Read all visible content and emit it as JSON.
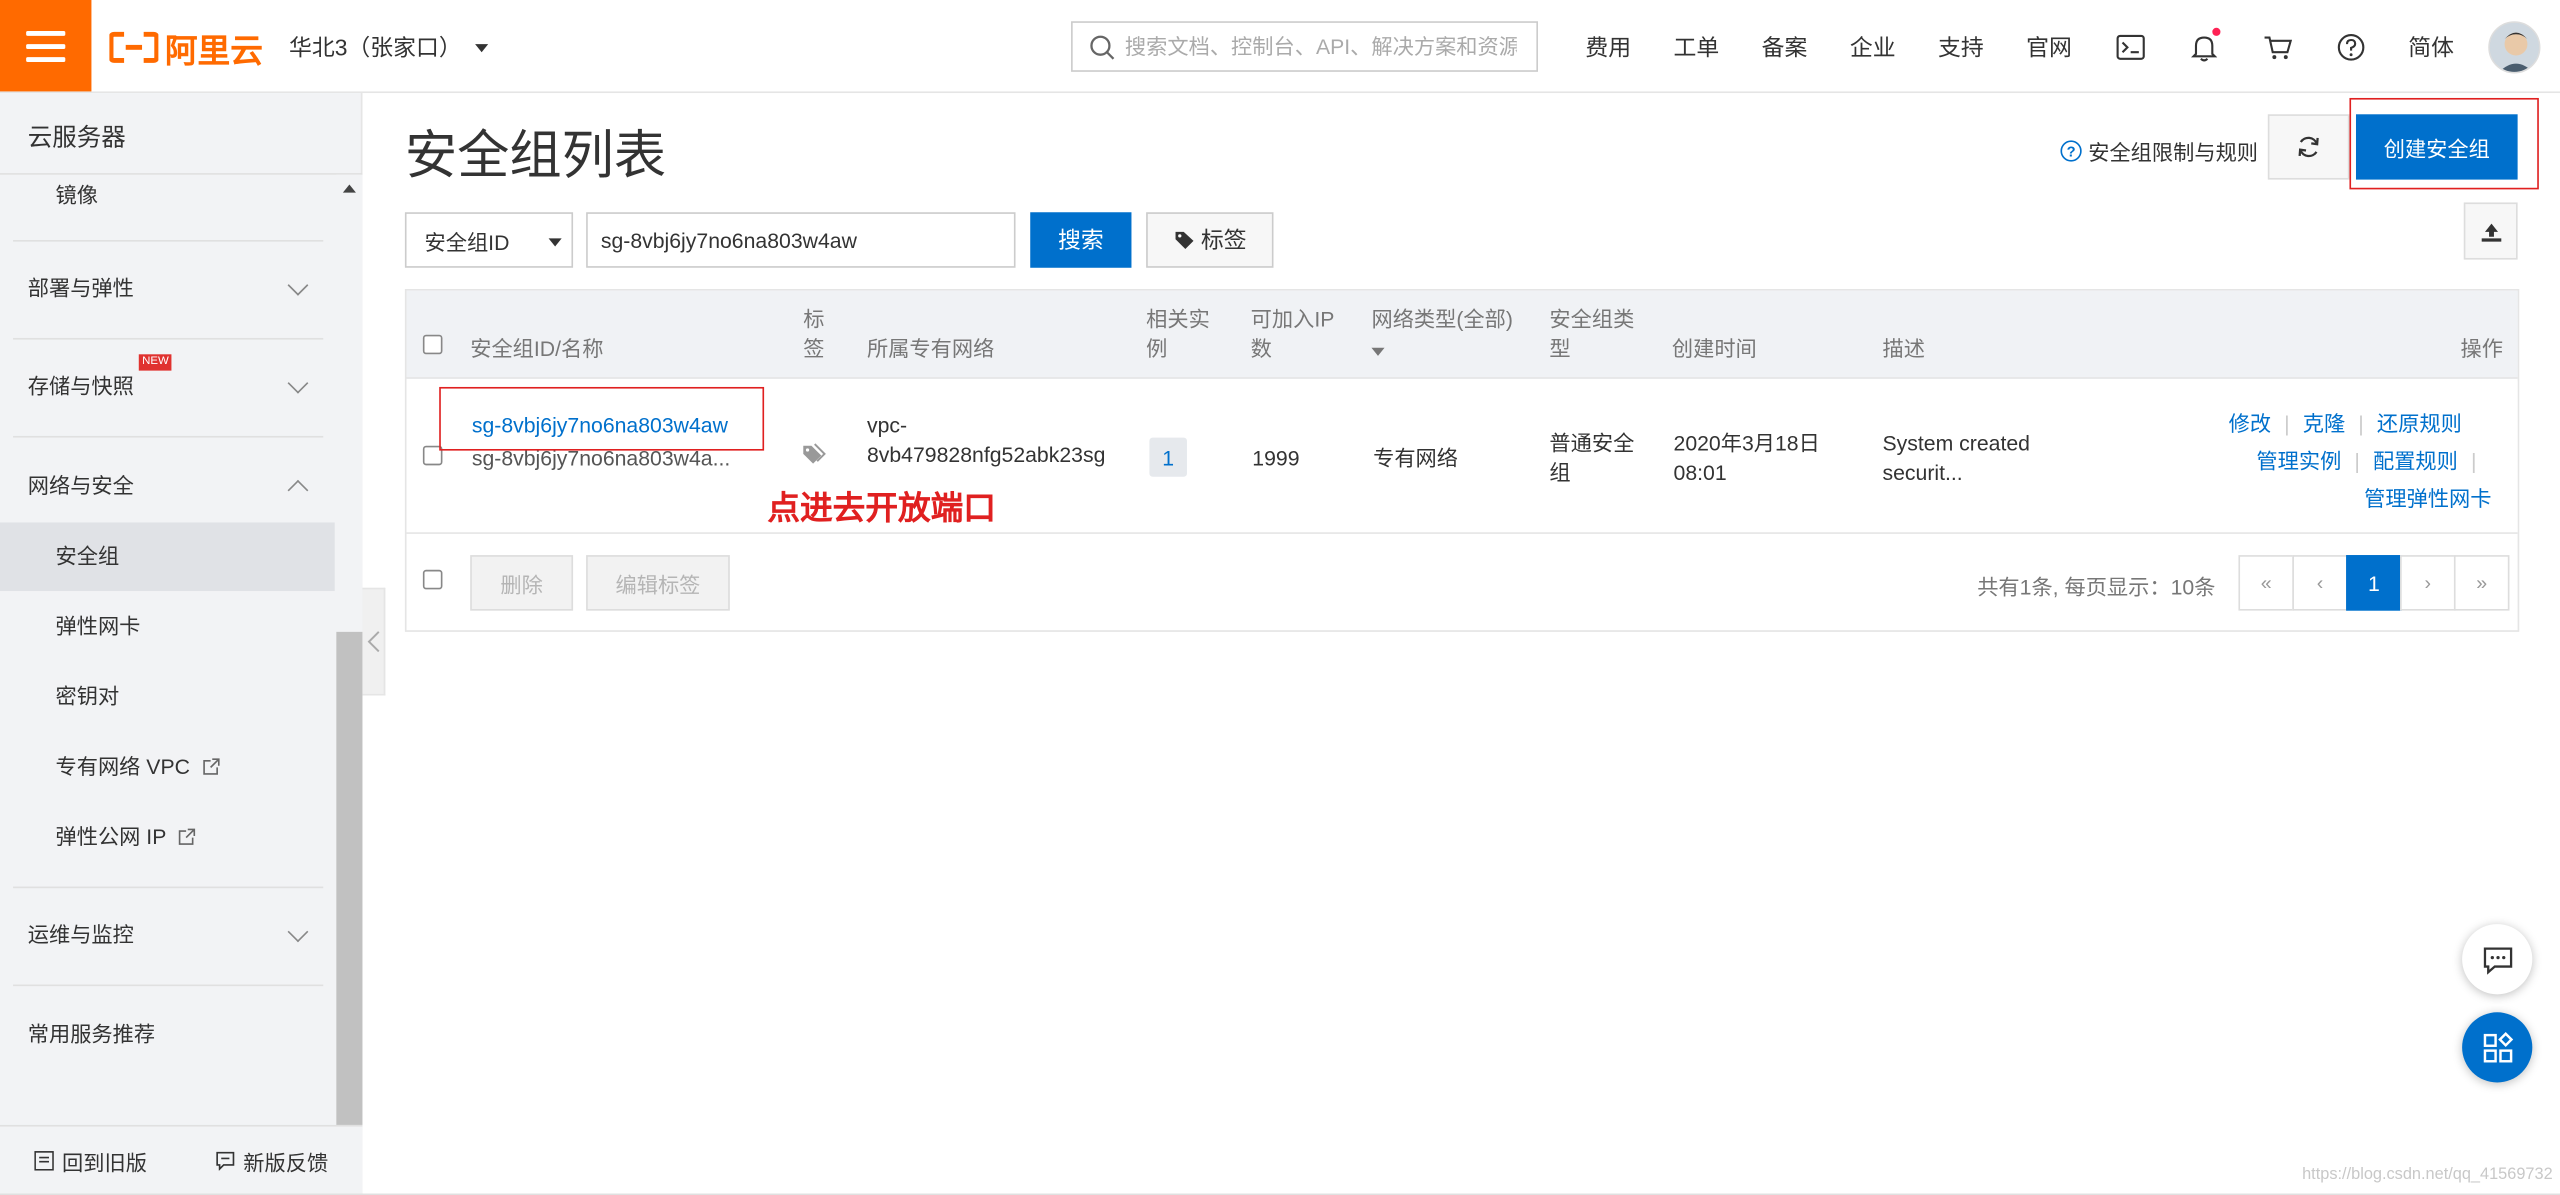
{
  "header": {
    "logo_text": "阿里云",
    "region": "华北3（张家口）",
    "search_placeholder": "搜索文档、控制台、API、解决方案和资源",
    "nav": [
      "费用",
      "工单",
      "备案",
      "企业",
      "支持",
      "官网"
    ],
    "language": "简体",
    "icons": [
      "terminal-icon",
      "bell-icon",
      "cart-icon",
      "help-icon"
    ]
  },
  "sidebar": {
    "title": "云服务器",
    "items": [
      {
        "label": "镜像"
      },
      {
        "label": "部署与弹性"
      },
      {
        "label": "存储与快照",
        "badge": "NEW"
      },
      {
        "label": "网络与安全"
      },
      {
        "label": "安全组"
      },
      {
        "label": "弹性网卡"
      },
      {
        "label": "密钥对"
      },
      {
        "label": "专有网络 VPC"
      },
      {
        "label": "弹性公网 IP"
      },
      {
        "label": "运维与监控"
      },
      {
        "label": "常用服务推荐"
      }
    ],
    "footer_left": "回到旧版",
    "footer_right": "新版反馈"
  },
  "main": {
    "title": "安全组列表",
    "help_link": "安全组限制与规则",
    "create_button": "创建安全组",
    "filter_select": "安全组ID",
    "filter_value": "sg-8vbj6jy7no6na803w4aw",
    "search_button": "搜索",
    "tag_button": "标签"
  },
  "table": {
    "headers": {
      "id": "安全组ID/名称",
      "tag1": "标",
      "tag2": "签",
      "vpc": "所属专有网络",
      "inst1": "相关实",
      "inst2": "例",
      "ip1": "可加入IP",
      "ip2": "数",
      "net1": "网络类型(全部)",
      "type1": "安全组类",
      "type2": "型",
      "created": "创建时间",
      "desc": "描述",
      "ops": "操作"
    },
    "row": {
      "id": "sg-8vbj6jy7no6na803w4aw",
      "name": "sg-8vbj6jy7no6na803w4a...",
      "vpc1": "vpc-",
      "vpc2": "8vb479828nfg52abk23sg",
      "instances": "1",
      "ip_count": "1999",
      "net_type": "专有网络",
      "sg_type1": "普通安全",
      "sg_type2": "组",
      "created1": "2020年3月18日",
      "created2": "08:01",
      "desc1": "System created",
      "desc2": "securit...",
      "ops": [
        "修改",
        "克隆",
        "还原规则",
        "管理实例",
        "配置规则",
        "管理弹性网卡"
      ]
    },
    "delete_button": "删除",
    "edit_tags_button": "编辑标签",
    "page_info": "共有1条, 每页显示：10条",
    "pager": [
      "«",
      "‹",
      "1",
      "›",
      "»"
    ]
  },
  "annotation": "点进去开放端口",
  "watermark": "https://blog.csdn.net/qq_41569732"
}
